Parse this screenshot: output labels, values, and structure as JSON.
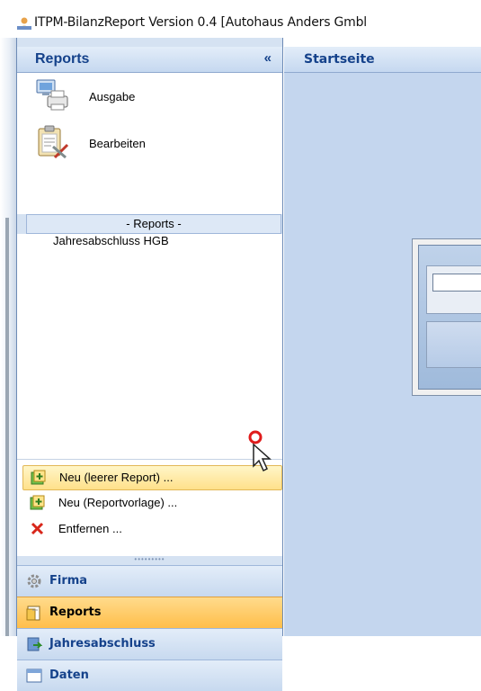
{
  "window": {
    "title": "ITPM-BilanzReport Version 0.4  [Autohaus Anders Gmbl"
  },
  "nav": {
    "title": "Reports",
    "collapse_glyph": "«",
    "actions": [
      {
        "label": "Ausgabe",
        "icon": "printer-monitor-icon"
      },
      {
        "label": "Bearbeiten",
        "icon": "edit-clipboard-icon"
      }
    ],
    "list_header": "- Reports -",
    "list_items": [
      "Jahresabschluss HGB"
    ],
    "context_items": [
      {
        "label": "Neu  (leerer Report) ...",
        "icon": "new-report-icon"
      },
      {
        "label": "Neu  (Reportvorlage) ...",
        "icon": "new-template-icon"
      },
      {
        "label": "Entfernen ...",
        "icon": "delete-x-icon"
      }
    ],
    "buttons": [
      {
        "label": "Firma",
        "icon": "gear-icon"
      },
      {
        "label": "Reports",
        "icon": "folder-document-icon"
      },
      {
        "label": "Jahresabschluss",
        "icon": "book-arrow-icon"
      },
      {
        "label": "Daten",
        "icon": "table-icon"
      }
    ]
  },
  "main": {
    "tab": "Startseite"
  },
  "colors": {
    "accent": "#15428b",
    "active": "#ffbe4a",
    "pane": "#d5e2f2"
  }
}
